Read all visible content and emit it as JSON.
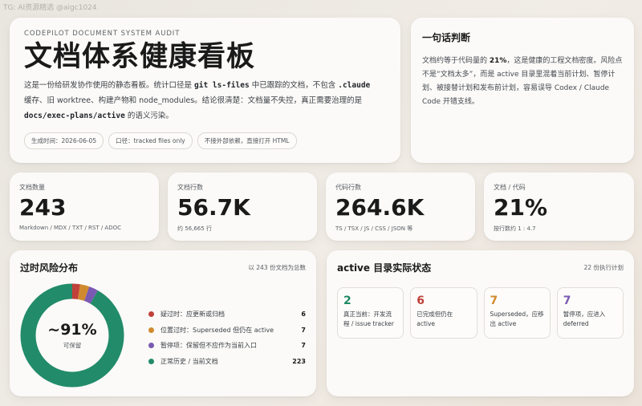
{
  "watermark": "TG: AI资源精选 @aigc1024",
  "hero": {
    "eyebrow": "CODEPILOT DOCUMENT SYSTEM AUDIT",
    "title": "文档体系健康看板",
    "desc": {
      "p1": "这是一份给研发协作使用的静态看板。统计口径是 ",
      "c1": "git ls-files",
      "p2": " 中已跟踪的文档，不包含 ",
      "c2": ".claude",
      "p3": "缓存、旧 worktree、构建产物和 node_modules。结论很清楚：文档量不失控，真正需要治理的是",
      "c3": "docs/exec-plans/active",
      "p4": " 的语义污染。"
    },
    "pills": [
      "生成时间：2026-06-05",
      "口径：tracked files only",
      "不接外部依赖，直接打开 HTML"
    ]
  },
  "verdict": {
    "title": "一句话判断",
    "t1": "文档约等于代码量的 ",
    "bold": "21%",
    "t2": "，这是健康的工程文档密度。风险点不是“文档太多”，而是 active 目录里混着当前计划、暂停计划、被接替计划和发布前计划，容易误导 Codex / Claude Code 开错支线。"
  },
  "stats": [
    {
      "label": "文档数量",
      "value": "243",
      "sub": "Markdown / MDX / TXT / RST / ADOC"
    },
    {
      "label": "文档行数",
      "value": "56.7K",
      "sub": "约 56,665 行"
    },
    {
      "label": "代码行数",
      "value": "264.6K",
      "sub": "TS / TSX / JS / CSS / JSON 等"
    },
    {
      "label": "文档 / 代码",
      "value": "21%",
      "sub": "按行数约 1 : 4.7"
    }
  ],
  "risk": {
    "title": "过时风险分布",
    "note": "以 243 份文档为总数",
    "center_value": "~91%",
    "center_label": "可保留",
    "items": [
      {
        "label": "疑过时：应更新或归档",
        "count": "6",
        "value": 6,
        "color": "#c0413a"
      },
      {
        "label": "位置过时：Superseded 但仍在 active",
        "count": "7",
        "value": 7,
        "color": "#d08a2e"
      },
      {
        "label": "暂停项：保留但不应作为当前入口",
        "count": "7",
        "value": 7,
        "color": "#7a59b3"
      },
      {
        "label": "正常历史 / 当前文档",
        "count": "223",
        "value": 223,
        "color": "#228b6a"
      }
    ]
  },
  "active": {
    "title": "active 目录实际状态",
    "note": "22 份执行计划",
    "tiles": [
      {
        "num": "2",
        "text": "真正当前：开发流程 / issue tracker",
        "color": "#1f8a63"
      },
      {
        "num": "6",
        "text": "已完成但仍在 active",
        "color": "#c0413a"
      },
      {
        "num": "7",
        "text": "Superseded，应移出 active",
        "color": "#d08a2e"
      },
      {
        "num": "7",
        "text": "暂停项，应进入 deferred",
        "color": "#7a59b3"
      }
    ]
  }
}
